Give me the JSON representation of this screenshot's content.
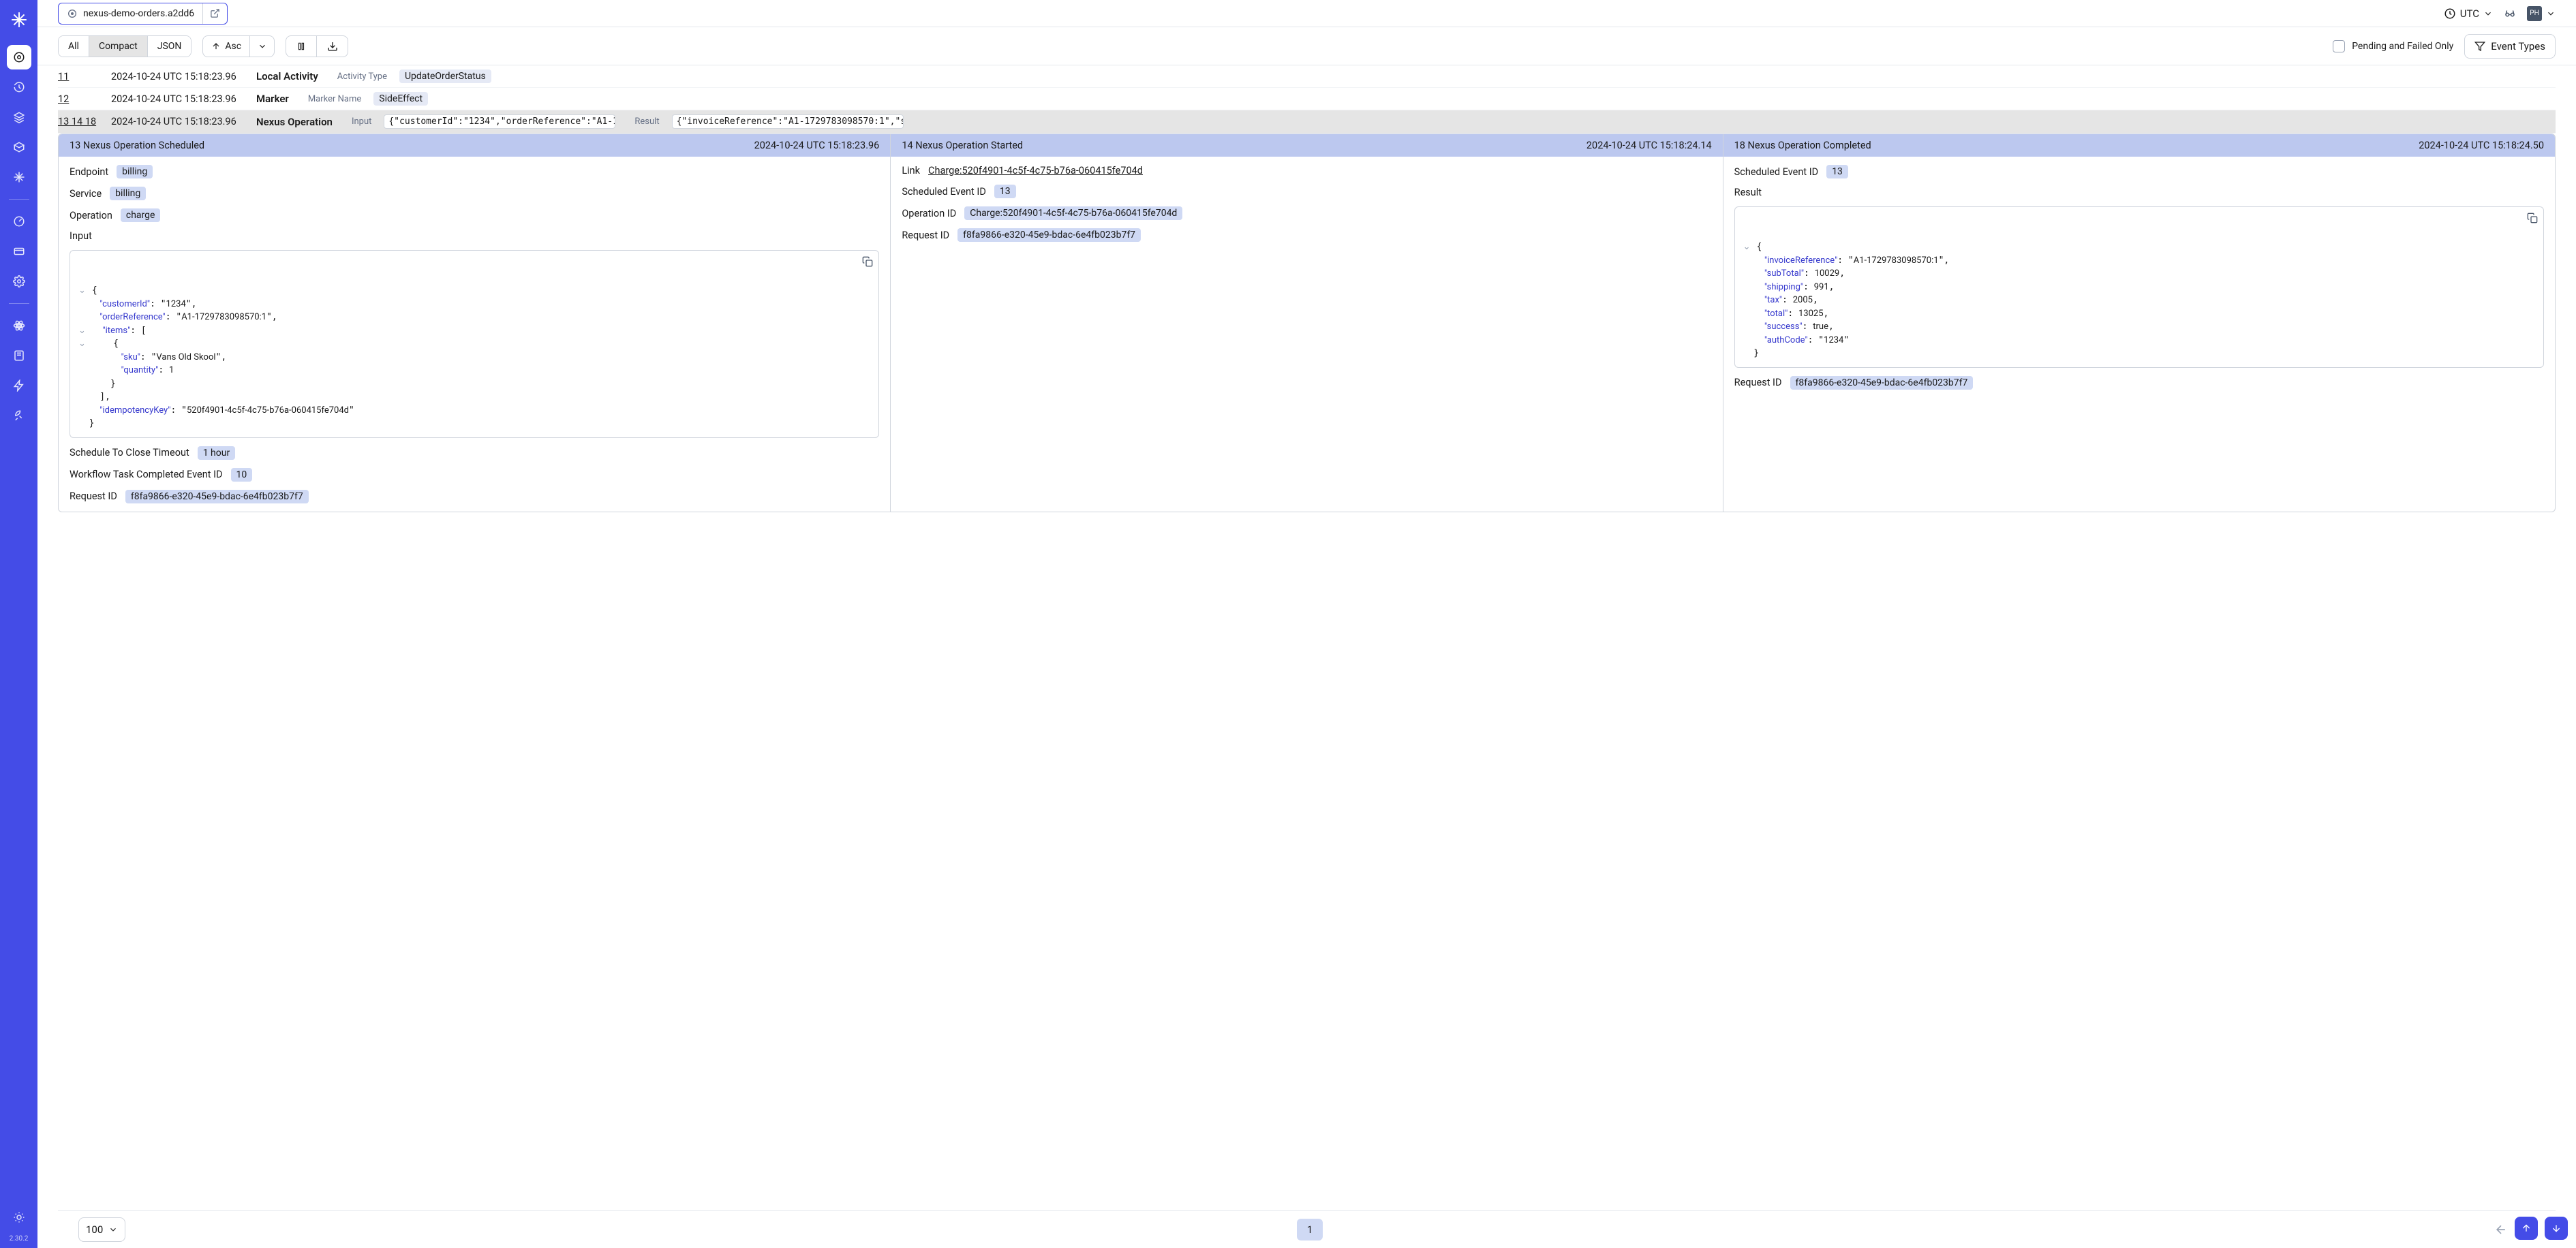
{
  "version": "2.30.2",
  "url": "nexus-demo-orders.a2dd6",
  "timezone": "UTC",
  "avatar": "PH",
  "viewModes": {
    "all": "All",
    "compact": "Compact",
    "json": "JSON"
  },
  "sort": "Asc",
  "pendingFailedLabel": "Pending and Failed Only",
  "eventTypesLabel": "Event Types",
  "rows": [
    {
      "idx": "11",
      "ts": "2024-10-24 UTC 15:18:23.96",
      "type": "Local Activity",
      "metaLabel": "Activity Type",
      "metaValue": "UpdateOrderStatus"
    },
    {
      "idx": "12",
      "ts": "2024-10-24 UTC 15:18:23.96",
      "type": "Marker",
      "metaLabel": "Marker Name",
      "metaValue": "SideEffect"
    }
  ],
  "nexusRow": {
    "idx": "13 14 18",
    "ts": "2024-10-24 UTC 15:18:23.96",
    "type": "Nexus Operation",
    "inputLabel": "Input",
    "inputCode": "{\"customerId\":\"1234\",\"orderReference\":\"A1-1729783098",
    "resultLabel": "Result",
    "resultCode": "{\"invoiceReference\":\"A1-1729783098570:1\",\"subTotal\":"
  },
  "panels": {
    "scheduled": {
      "title": "13 Nexus Operation Scheduled",
      "ts": "2024-10-24 UTC 15:18:23.96",
      "endpointLabel": "Endpoint",
      "endpoint": "billing",
      "serviceLabel": "Service",
      "service": "billing",
      "operationLabel": "Operation",
      "operation": "charge",
      "inputLabel": "Input",
      "timeoutLabel": "Schedule To Close Timeout",
      "timeout": "1 hour",
      "wftLabel": "Workflow Task Completed Event ID",
      "wft": "10",
      "reqLabel": "Request ID",
      "req": "f8fa9866-e320-45e9-bdac-6e4fb023b7f7"
    },
    "started": {
      "title": "14 Nexus Operation Started",
      "ts": "2024-10-24 UTC 15:18:24.14",
      "linkLabel": "Link",
      "link": "Charge:520f4901-4c5f-4c75-b76a-060415fe704d",
      "schedLabel": "Scheduled Event ID",
      "sched": "13",
      "opIdLabel": "Operation ID",
      "opId": "Charge:520f4901-4c5f-4c75-b76a-060415fe704d",
      "reqLabel": "Request ID",
      "req": "f8fa9866-e320-45e9-bdac-6e4fb023b7f7"
    },
    "completed": {
      "title": "18 Nexus Operation Completed",
      "ts": "2024-10-24 UTC 15:18:24.50",
      "schedLabel": "Scheduled Event ID",
      "sched": "13",
      "resultLabel": "Result",
      "reqLabel": "Request ID",
      "req": "f8fa9866-e320-45e9-bdac-6e4fb023b7f7"
    }
  },
  "inputJson": {
    "customerId": "1234",
    "orderReference": "A1-1729783098570:1",
    "items": [
      {
        "sku": "Vans Old Skool",
        "quantity": 1
      }
    ],
    "idempotencyKey": "520f4901-4c5f-4c75-b76a-060415fe704d"
  },
  "resultJson": {
    "invoiceReference": "A1-1729783098570:1",
    "subTotal": 10029,
    "shipping": 991,
    "tax": 2005,
    "total": 13025,
    "success": true,
    "authCode": "1234"
  },
  "pagination": {
    "pageSize": "100",
    "page": "1"
  }
}
